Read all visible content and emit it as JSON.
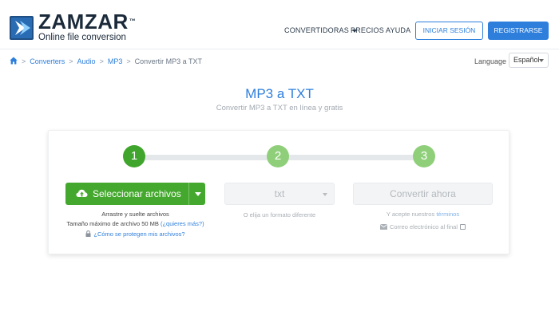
{
  "header": {
    "brand": "ZAMZAR",
    "brand_tm": "™",
    "tagline": "Online file conversion",
    "nav": {
      "converters": "CONVERTIDORAS",
      "pricing": "PRECIOS",
      "help": "AYUDA"
    },
    "login_label": "INICIAR SESIÓN",
    "register_label": "REGISTRARSE",
    "colors": {
      "accent": "#2e7fdc",
      "logo_dark": "#1f4f84"
    }
  },
  "breadcrumb": {
    "items": [
      "Converters",
      "Audio",
      "MP3"
    ],
    "separator": ">",
    "current": "Convertir MP3 a TXT"
  },
  "language": {
    "label": "Language",
    "selected": "Español"
  },
  "main": {
    "title": "MP3 a TXT",
    "subtitle": "Convertir MP3 a TXT en línea y gratis"
  },
  "converter": {
    "steps": [
      "1",
      "2",
      "3"
    ],
    "step_colors": {
      "active": "#3fa52c",
      "inactive": "#8fcf7a"
    },
    "select_button": "Seleccionar archivos",
    "drag_text": "Arrastre y suelte archivos",
    "max_size_text": "Tamaño máximo de archivo 50 MB",
    "more_link": "(¿quieres más?)",
    "protect_link": "¿Cómo se protegen mis archivos?",
    "format_value": "txt",
    "format_hint": "O elija un formato diferente",
    "convert_button": "Convertir ahora",
    "terms_prefix": "Y acepte nuestros",
    "terms_link": "términos",
    "email_label": "Correo electrónico al final"
  }
}
